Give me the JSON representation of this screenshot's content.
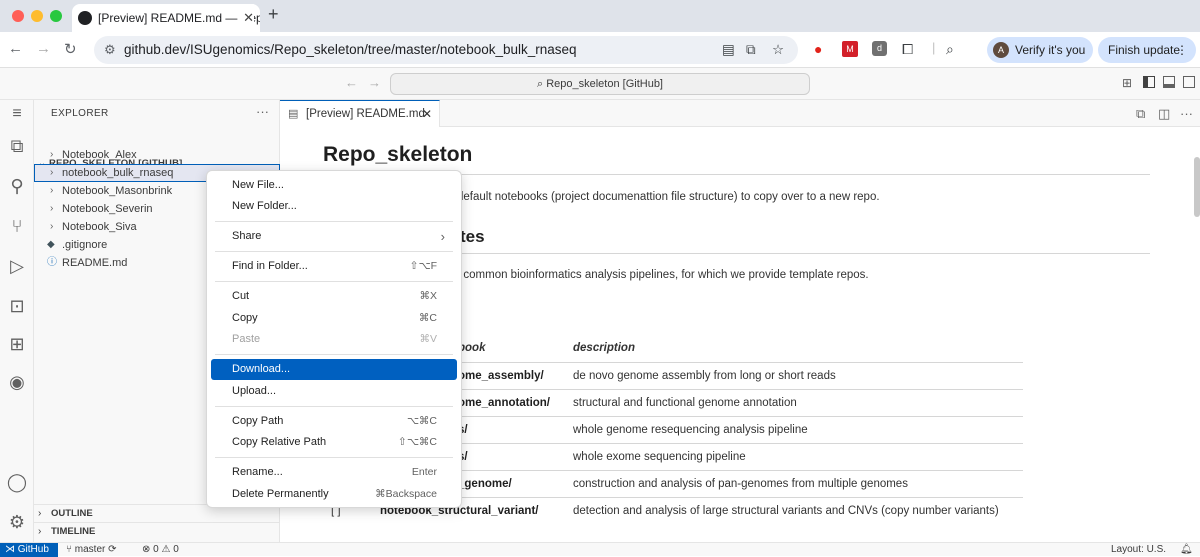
{
  "browser": {
    "tab_title": "[Preview] README.md — Repo",
    "url": "github.dev/ISUgenomics/Repo_skeleton/tree/master/notebook_bulk_rnaseq",
    "verify_label": "Verify it's you",
    "avatar_letter": "A",
    "finish_label": "Finish update"
  },
  "vscode": {
    "command_center": "Repo_skeleton [GitHub]"
  },
  "explorer": {
    "title": "EXPLORER",
    "root": "REPO_SKELETON [GITHUB]",
    "items": [
      {
        "label": "Notebook_Alex",
        "kind": "folder"
      },
      {
        "label": "notebook_bulk_rnaseq",
        "kind": "folder"
      },
      {
        "label": "Notebook_Masonbrink",
        "kind": "folder"
      },
      {
        "label": "Notebook_Severin",
        "kind": "folder"
      },
      {
        "label": "Notebook_Siva",
        "kind": "folder"
      },
      {
        "label": ".gitignore",
        "kind": "file"
      },
      {
        "label": "README.md",
        "kind": "file"
      }
    ],
    "outline": "OUTLINE",
    "timeline": "TIMELINE"
  },
  "editor": {
    "tab_label": "[Preview] README.md"
  },
  "preview": {
    "h1": "Repo_skeleton",
    "intro": "default notebooks (project documenattion file structure) to copy over to a new repo.",
    "h2": "tes",
    "para2": "f common bioinformatics analysis pipelines, for which we provide template repos.",
    "col_notebook": "book",
    "col_description": "description",
    "rows": [
      {
        "check": "",
        "notebook": "ome_assembly/",
        "description": "de novo genome assembly from long or short reads"
      },
      {
        "check": "",
        "notebook": "ome_annotation/",
        "description": "structural and functional genome annotation"
      },
      {
        "check": "",
        "notebook": "s/",
        "description": "whole genome resequencing analysis pipeline"
      },
      {
        "check": "",
        "notebook": "s/",
        "description": "whole exome sequencing pipeline"
      },
      {
        "check": "",
        "notebook": "_genome/",
        "description": "construction and analysis of pan-genomes from multiple genomes"
      },
      {
        "check": "[ ]",
        "notebook": "notebook_structural_variant/",
        "description": "detection and analysis of large structural variants and CNVs (copy number variants)"
      }
    ]
  },
  "context_menu": {
    "new_file": "New File...",
    "new_folder": "New Folder...",
    "share": "Share",
    "find_in_folder": "Find in Folder...",
    "find_in_folder_sc": "⇧⌥F",
    "cut": "Cut",
    "cut_sc": "⌘X",
    "copy": "Copy",
    "copy_sc": "⌘C",
    "paste": "Paste",
    "paste_sc": "⌘V",
    "download": "Download...",
    "upload": "Upload...",
    "copy_path": "Copy Path",
    "copy_path_sc": "⌥⌘C",
    "copy_relative_path": "Copy Relative Path",
    "copy_relative_path_sc": "⇧⌥⌘C",
    "rename": "Rename...",
    "rename_sc": "Enter",
    "delete": "Delete Permanently",
    "delete_sc": "⌘Backspace"
  },
  "status": {
    "remote": "GitHub",
    "branch": "master",
    "errors": "0",
    "warnings": "0",
    "layout": "Layout: U.S."
  },
  "colors": {
    "accent": "#005fb8",
    "menu_highlight": "#0060c0"
  }
}
